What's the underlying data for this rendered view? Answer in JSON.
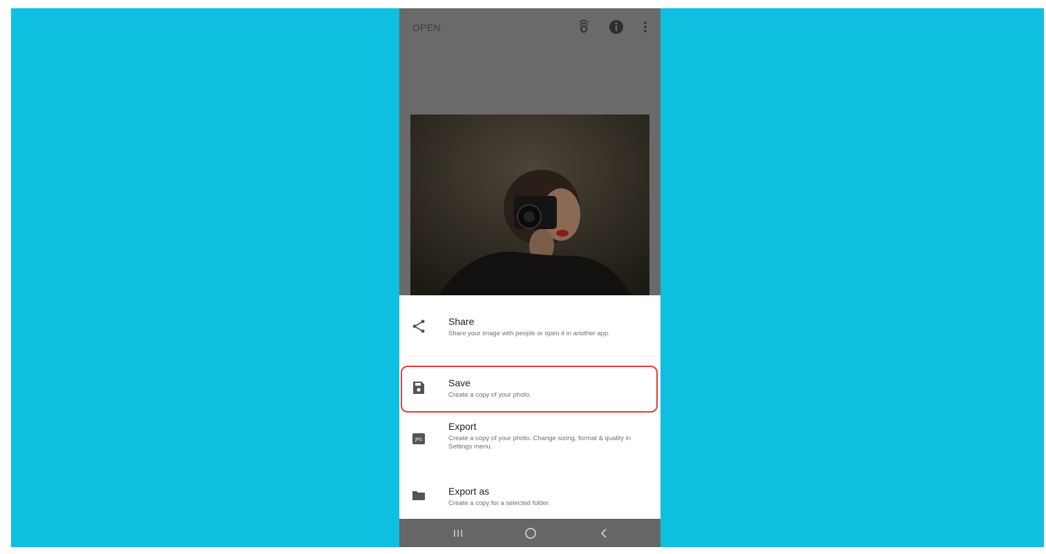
{
  "header": {
    "open_label": "OPEN"
  },
  "icons": {
    "looks": "layers-badge-icon",
    "info": "info-icon",
    "more": "more-vert-icon"
  },
  "menu": {
    "items": [
      {
        "title": "Share",
        "description": "Share your image with people or open it in another app.",
        "icon": "share-icon"
      },
      {
        "title": "Save",
        "description": "Create a copy of your photo.",
        "icon": "save-floppy-icon",
        "highlighted": true
      },
      {
        "title": "Export",
        "description": "Create a copy of your photo. Change sizing, format & quality in Settings menu.",
        "icon": "jpg-file-icon"
      },
      {
        "title": "Export as",
        "description": "Create a copy for a selected folder.",
        "icon": "folder-icon"
      }
    ]
  },
  "navbar": {
    "buttons": [
      "recents-icon",
      "home-icon",
      "back-icon"
    ]
  },
  "colors": {
    "background": "#0fbfe0",
    "highlight": "#e53935",
    "overlay": "#6a6a6a",
    "sheet": "#ffffff"
  }
}
